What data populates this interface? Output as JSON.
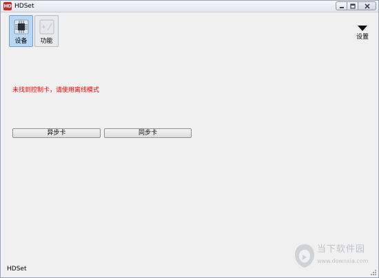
{
  "window": {
    "title": "HDSet",
    "logo_text": "HD",
    "controls": [
      "minimize",
      "maximize",
      "close"
    ]
  },
  "toolbar": {
    "items": [
      {
        "label": "设备",
        "icon": "chip-icon",
        "active": true
      },
      {
        "label": "功能",
        "icon": "function-icon",
        "active": false
      }
    ],
    "settings_label": "设置"
  },
  "main": {
    "error_message": "未找到控制卡，请使用离线模式",
    "buttons": [
      {
        "label": "异步卡"
      },
      {
        "label": "同步卡"
      }
    ]
  },
  "status_bar": {
    "text": "HDSet"
  },
  "watermark": {
    "text_cn": "当下软件园",
    "url": "www.downxia.com"
  },
  "colors": {
    "error": "#ff0000",
    "active_tab": "#b9d6f2",
    "logo": "#d4232a"
  }
}
